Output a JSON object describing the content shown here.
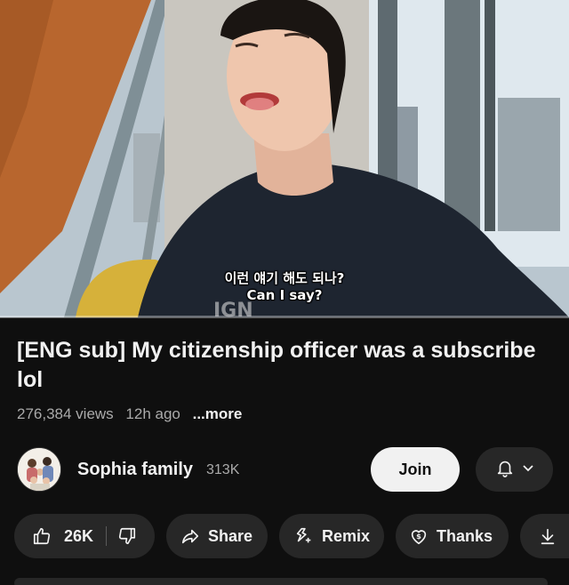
{
  "video": {
    "subtitle_korean": "이런 얘기 해도 되나?",
    "subtitle_english": "Can I say?",
    "progress_fraction": 0.0,
    "accent_color": "#ff0000"
  },
  "title": "[ENG sub] My citizenship officer was a subscribe lol",
  "meta": {
    "views": "276,384 views",
    "age": "12h ago",
    "more": "...more"
  },
  "channel": {
    "name": "Sophia family",
    "subscribers": "313K",
    "join_label": "Join",
    "bell_icon": "bell-icon",
    "dropdown_icon": "chevron-down-icon"
  },
  "actions": {
    "like_count": "26K",
    "share_label": "Share",
    "remix_label": "Remix",
    "thanks_label": "Thanks",
    "icons": [
      "thumbs-up-icon",
      "thumbs-down-icon",
      "share-arrow-icon",
      "remix-icon",
      "thanks-heart-dollar-icon",
      "download-icon"
    ]
  }
}
